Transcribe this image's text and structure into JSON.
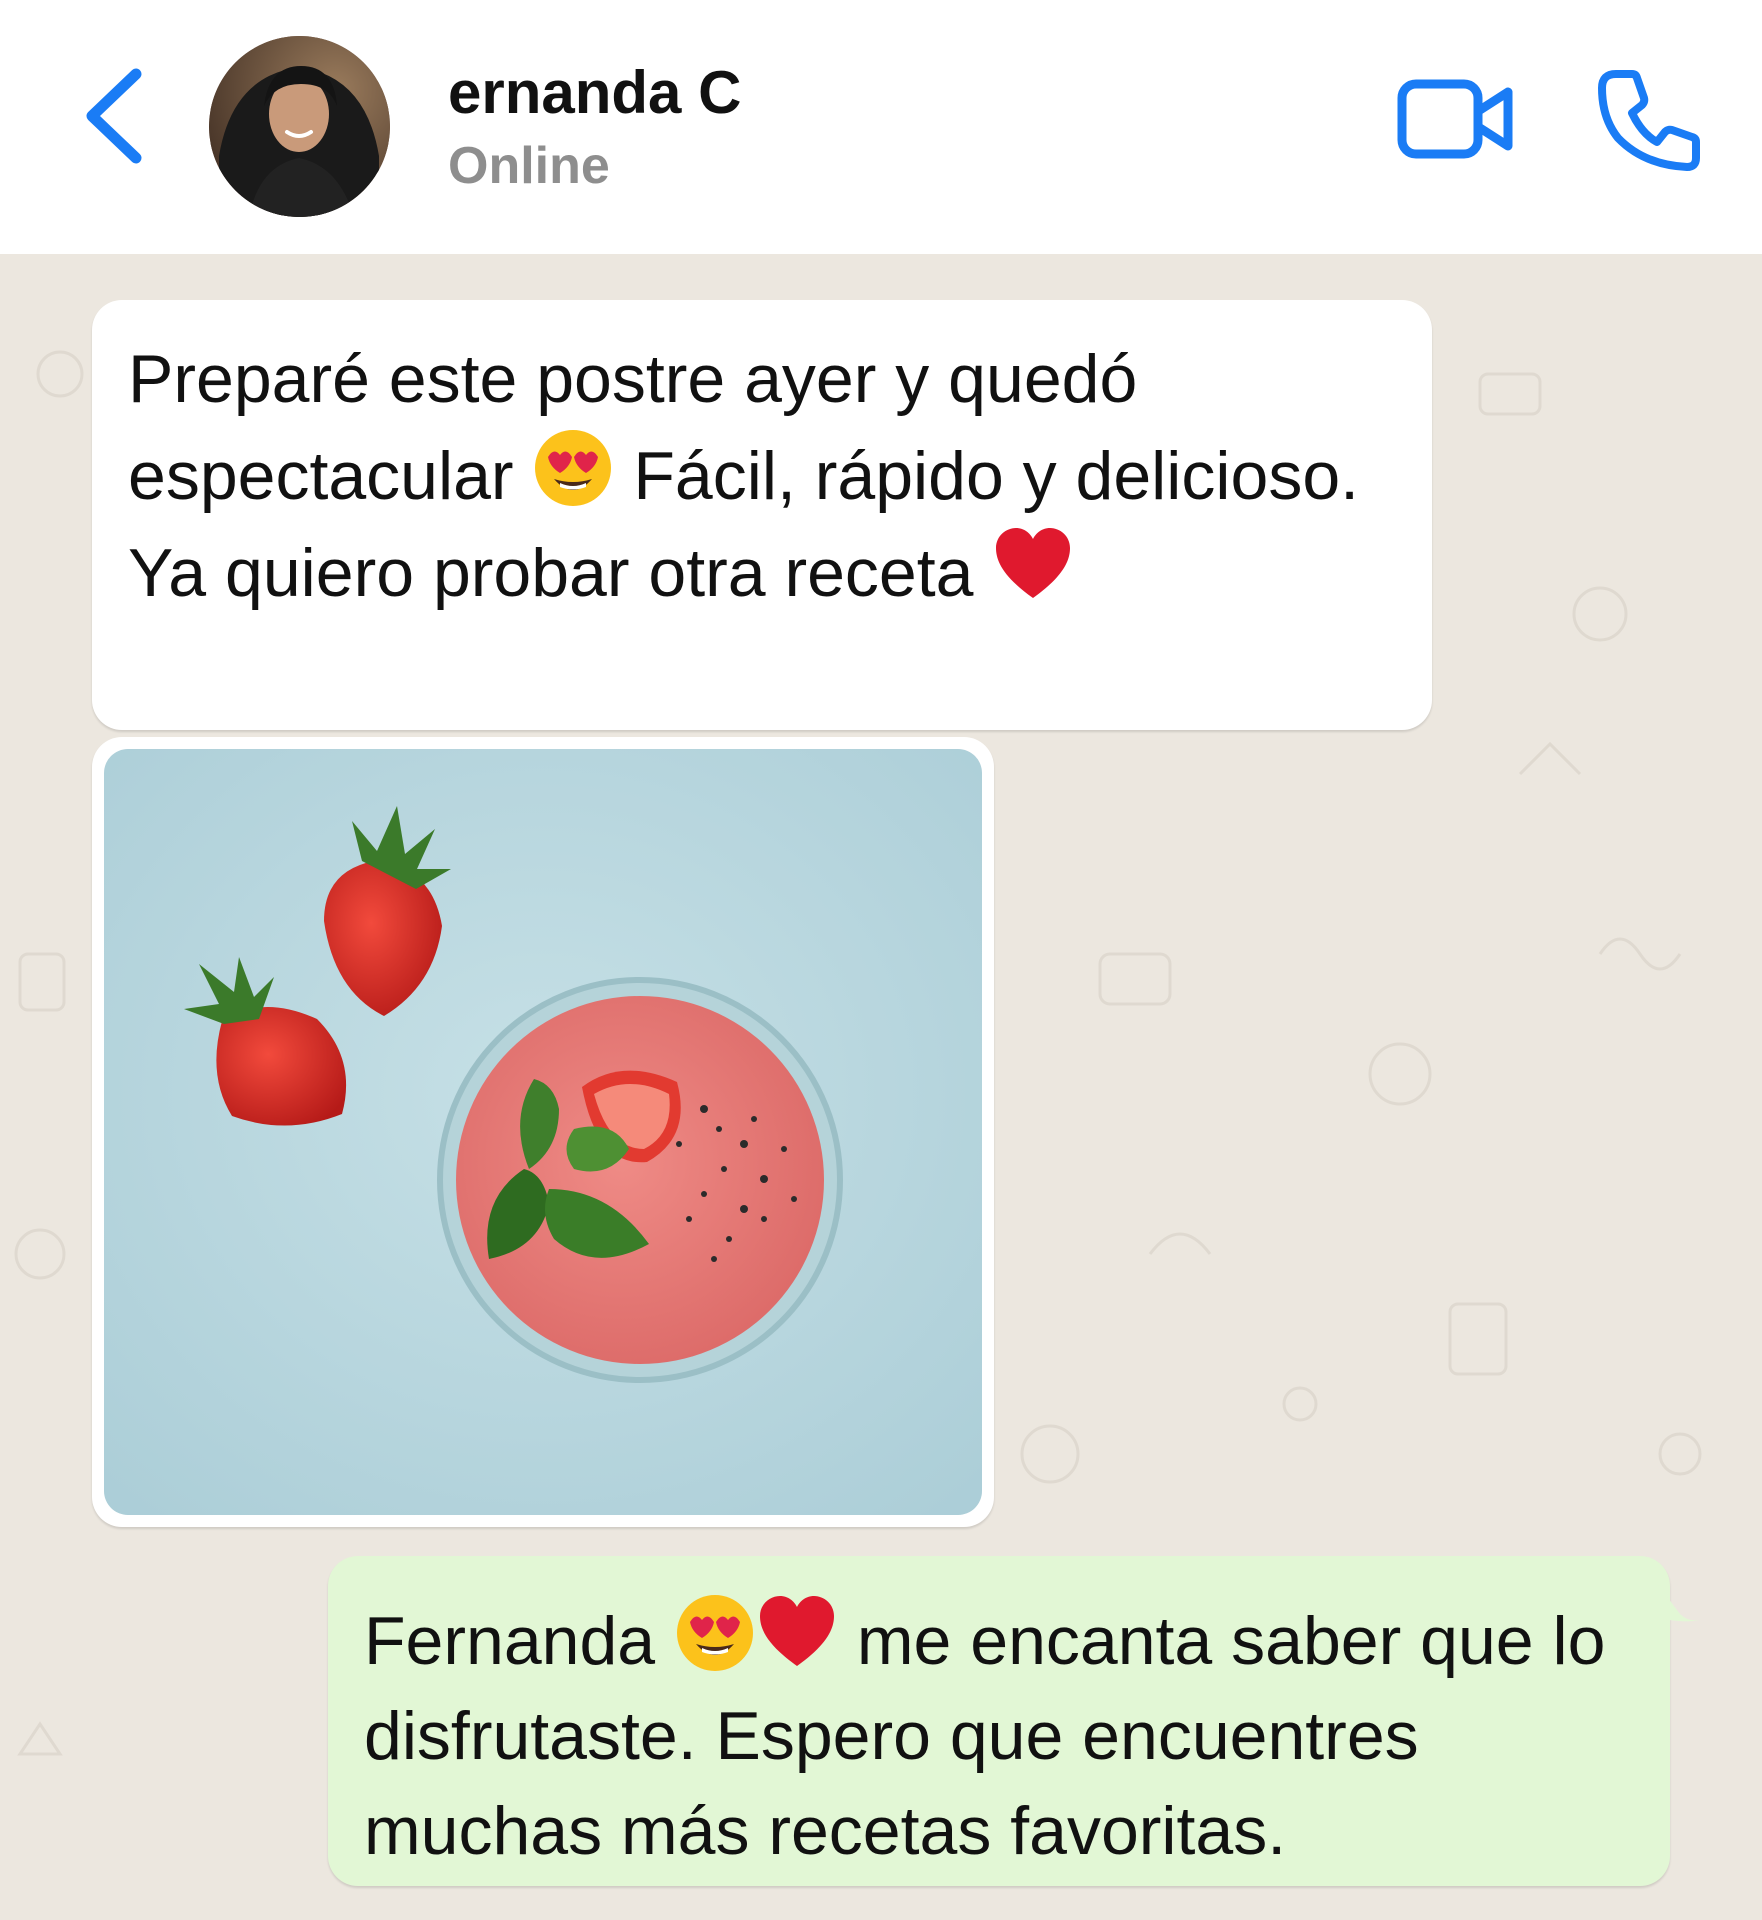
{
  "header": {
    "contact_name": "ernanda C",
    "status": "Online"
  },
  "messages": [
    {
      "direction": "incoming",
      "type": "text",
      "text_parts": [
        "Preparé este postre ayer y quedó espectacular",
        "Fácil, rápido y delicioso. Ya quiero probar otra receta"
      ],
      "emojis": [
        "heart-eyes-emoji",
        "red-heart-emoji"
      ]
    },
    {
      "direction": "incoming",
      "type": "image",
      "image": "strawberry-smoothie-photo"
    },
    {
      "direction": "outgoing",
      "type": "text",
      "text_parts": [
        "Fernanda",
        "me encanta saber que lo disfrutaste. Espero que encuentres muchas más recetas favoritas."
      ],
      "emojis": [
        "heart-eyes-emoji",
        "red-heart-emoji"
      ]
    }
  ],
  "icons": {
    "back": "back-chevron-icon",
    "video_call": "video-camera-icon",
    "voice_call": "phone-icon"
  },
  "colors": {
    "accent": "#1a7cf5",
    "incoming_bubble": "#ffffff",
    "outgoing_bubble": "#e2f7d5",
    "chat_background": "#ece7df"
  }
}
